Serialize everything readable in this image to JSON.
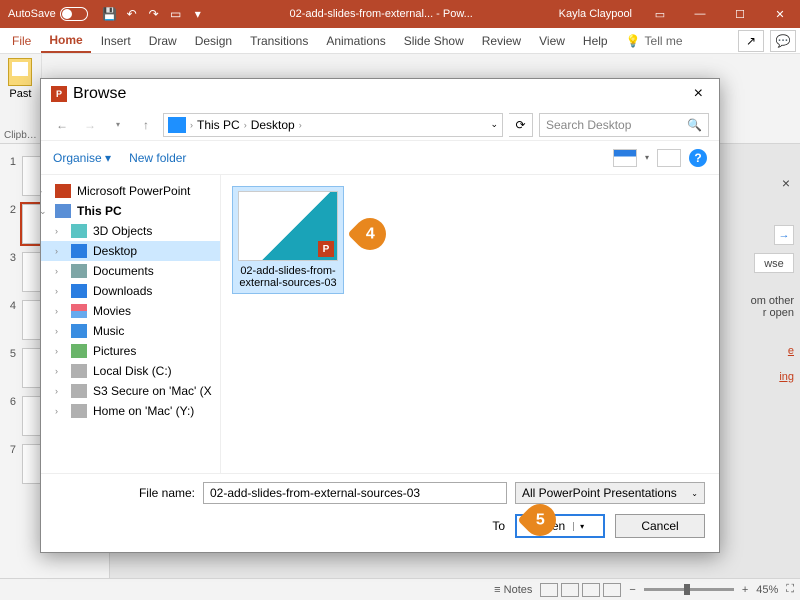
{
  "titlebar": {
    "autosave_label": "AutoSave",
    "doc_title": "02-add-slides-from-external... - Pow...",
    "username": "Kayla Claypool"
  },
  "ribbon": {
    "tabs": [
      "File",
      "Home",
      "Insert",
      "Draw",
      "Design",
      "Transitions",
      "Animations",
      "Slide Show",
      "Review",
      "View",
      "Help"
    ],
    "active_tab_index": 1,
    "tell_me": "Tell me",
    "groups": {
      "clipboard": "Clipb…",
      "paste": "Past"
    }
  },
  "slides": {
    "count": 7,
    "selected": 2
  },
  "right_pane": {
    "wse": "wse",
    "txt1a": "om other",
    "txt1b": "r open",
    "link1": "e",
    "link2": "ing"
  },
  "dialog": {
    "title": "Browse",
    "breadcrumb": [
      "This PC",
      "Desktop"
    ],
    "search_placeholder": "Search Desktop",
    "toolbar": {
      "organise": "Organise",
      "new_folder": "New folder"
    },
    "tree": [
      {
        "label": "Microsoft PowerPoint",
        "icon": "ic-pp",
        "level": 1,
        "chev": "›"
      },
      {
        "label": "This PC",
        "icon": "ic-pc",
        "level": 1,
        "chev": "⌄",
        "bold": true
      },
      {
        "label": "3D Objects",
        "icon": "ic-3d",
        "level": 2,
        "chev": "›"
      },
      {
        "label": "Desktop",
        "icon": "ic-desktop",
        "level": 2,
        "chev": "›",
        "selected": true
      },
      {
        "label": "Documents",
        "icon": "ic-docs",
        "level": 2,
        "chev": "›"
      },
      {
        "label": "Downloads",
        "icon": "ic-dl",
        "level": 2,
        "chev": "›"
      },
      {
        "label": "Movies",
        "icon": "ic-mov",
        "level": 2,
        "chev": "›"
      },
      {
        "label": "Music",
        "icon": "ic-music",
        "level": 2,
        "chev": "›"
      },
      {
        "label": "Pictures",
        "icon": "ic-pic",
        "level": 2,
        "chev": "›"
      },
      {
        "label": "Local Disk (C:)",
        "icon": "ic-disk",
        "level": 2,
        "chev": "›"
      },
      {
        "label": "S3 Secure on 'Mac' (X",
        "icon": "ic-disk",
        "level": 2,
        "chev": "›"
      },
      {
        "label": "Home on 'Mac' (Y:)",
        "icon": "ic-disk",
        "level": 2,
        "chev": "›"
      }
    ],
    "file": {
      "name": "02-add-slides-from-external-sources-03"
    },
    "footer": {
      "filename_label": "File name:",
      "filename_value": "02-add-slides-from-external-sources-03",
      "filter": "All PowerPoint Presentations",
      "tools": "To",
      "open": "Open",
      "cancel": "Cancel"
    }
  },
  "callouts": {
    "c4": "4",
    "c5": "5"
  },
  "statusbar": {
    "notes": "Notes",
    "zoom": "45%"
  }
}
